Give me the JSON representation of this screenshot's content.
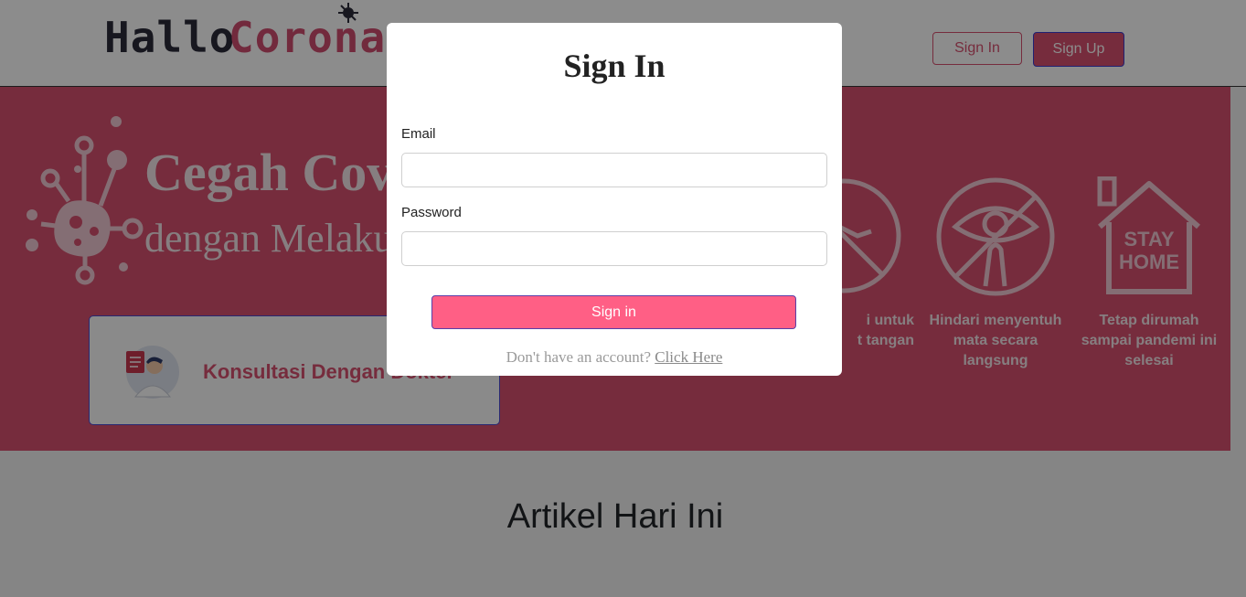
{
  "header": {
    "logo_word_1": "Hallo",
    "logo_word_2": "Corona",
    "signin_label": "Sign In",
    "signup_label": "Sign Up"
  },
  "hero": {
    "title": "Cegah Covid",
    "subtitle": "dengan Melakukan",
    "consult_label": "Konsultasi Dengan Dokter",
    "tips": [
      {
        "icon": "no-handshake-icon",
        "text": "i untuk\nt tangan"
      },
      {
        "icon": "no-touch-eye-icon",
        "text": "Hindari menyentuh\nmata secara\nlangsung"
      },
      {
        "icon": "stay-home-icon",
        "text": "Tetap dirumah\nsampai pandemi ini\nselesai",
        "badge_line1": "STAY",
        "badge_line2": "HOME"
      }
    ]
  },
  "content": {
    "section_title": "Artikel Hari Ini"
  },
  "modal": {
    "title": "Sign In",
    "email_label": "Email",
    "email_value": "",
    "password_label": "Password",
    "password_value": "",
    "submit_label": "Sign in",
    "hint_text": "Don't have an account?",
    "hint_link": "Click Here"
  },
  "colors": {
    "brand_pink": "#d8506f",
    "button_pink": "#ff5f85",
    "border_blue": "#4a4ad0"
  }
}
